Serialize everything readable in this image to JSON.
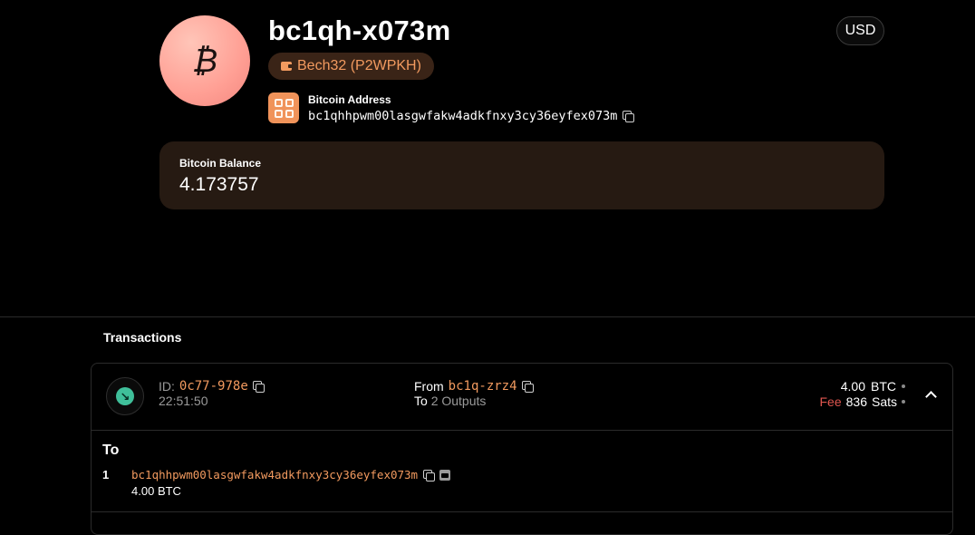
{
  "wallet": {
    "avatar_symbol": "₿",
    "title": "bc1qh-x073m",
    "type_badge": "Bech32 (P2WPKH)",
    "address_label": "Bitcoin Address",
    "address": "bc1qhhpwm00lasgwfakw4adkfnxy3cy36eyfex073m",
    "currency": "USD"
  },
  "balance": {
    "label": "Bitcoin Balance",
    "value": "4.173757"
  },
  "transactions": {
    "heading": "Transactions",
    "items": [
      {
        "direction_icon": "arrow-down-right-icon",
        "id_label": "ID:",
        "id": "0c77-978e",
        "time": "22:51:50",
        "from_label": "From",
        "from": "bc1q-zrz4",
        "to_label": "To",
        "to": "2 Outputs",
        "amount_value": "4.00",
        "amount_unit": "BTC",
        "fee_label": "Fee",
        "fee_value": "836",
        "fee_unit": "Sats",
        "expanded": true,
        "outputs_heading": "To",
        "outputs": [
          {
            "index": "1",
            "address": "bc1qhhpwm00lasgwfakw4adkfnxy3cy36eyfex073m",
            "amount": "4.00",
            "unit": "BTC"
          }
        ]
      }
    ]
  },
  "colors": {
    "accent": "#f29a5f",
    "fee_red": "#e0564f",
    "receive_green": "#3fbf9a",
    "card_bg": "#261a12"
  }
}
